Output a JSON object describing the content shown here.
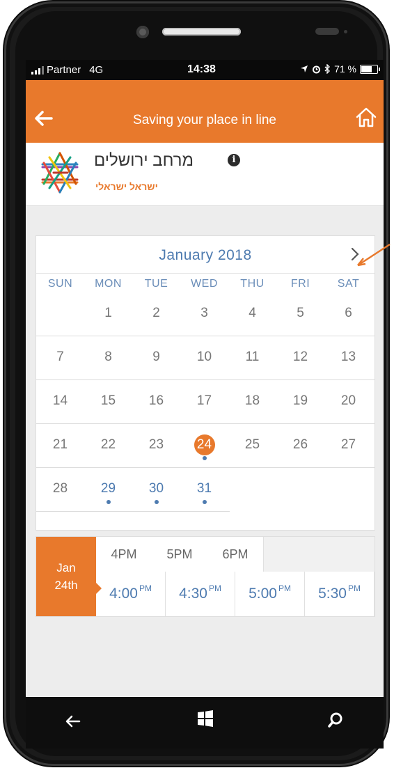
{
  "status": {
    "carrier": "Partner",
    "network": "4G",
    "time": "14:38",
    "battery": "71 %"
  },
  "appbar": {
    "title": "Saving your place in line"
  },
  "venue": {
    "name": "מרחב ירושלים",
    "subtitle": "ישראל ישראלי"
  },
  "calendar": {
    "title": "January 2018",
    "weekdays": [
      "SUN",
      "MON",
      "TUE",
      "WED",
      "THU",
      "FRI",
      "SAT"
    ],
    "weeks": [
      [
        "",
        "1",
        "2",
        "3",
        "4",
        "5",
        "6"
      ],
      [
        "7",
        "8",
        "9",
        "10",
        "11",
        "12",
        "13"
      ],
      [
        "14",
        "15",
        "16",
        "17",
        "18",
        "19",
        "20"
      ],
      [
        "21",
        "22",
        "23",
        "24",
        "25",
        "26",
        "27"
      ],
      [
        "28",
        "29",
        "30",
        "31",
        "",
        "",
        ""
      ]
    ],
    "selected_day": "24",
    "available_days": [
      "24",
      "29",
      "30",
      "31"
    ]
  },
  "timeslots": {
    "date_month": "Jan",
    "date_day": "24th",
    "hours": [
      "4PM",
      "5PM",
      "6PM"
    ],
    "slots": [
      {
        "time": "4:00",
        "suffix": "PM"
      },
      {
        "time": "4:30",
        "suffix": "PM"
      },
      {
        "time": "5:00",
        "suffix": "PM"
      },
      {
        "time": "5:30",
        "suffix": "PM"
      }
    ]
  },
  "colors": {
    "accent": "#e8792c",
    "link": "#4e7bb0"
  },
  "icons": {
    "back": "arrow-left-icon",
    "home": "house-icon",
    "info": "info-icon",
    "next": "chevron-right-icon",
    "nav_back": "android-back-icon",
    "nav_home": "windows-logo-icon",
    "nav_search": "search-icon"
  }
}
